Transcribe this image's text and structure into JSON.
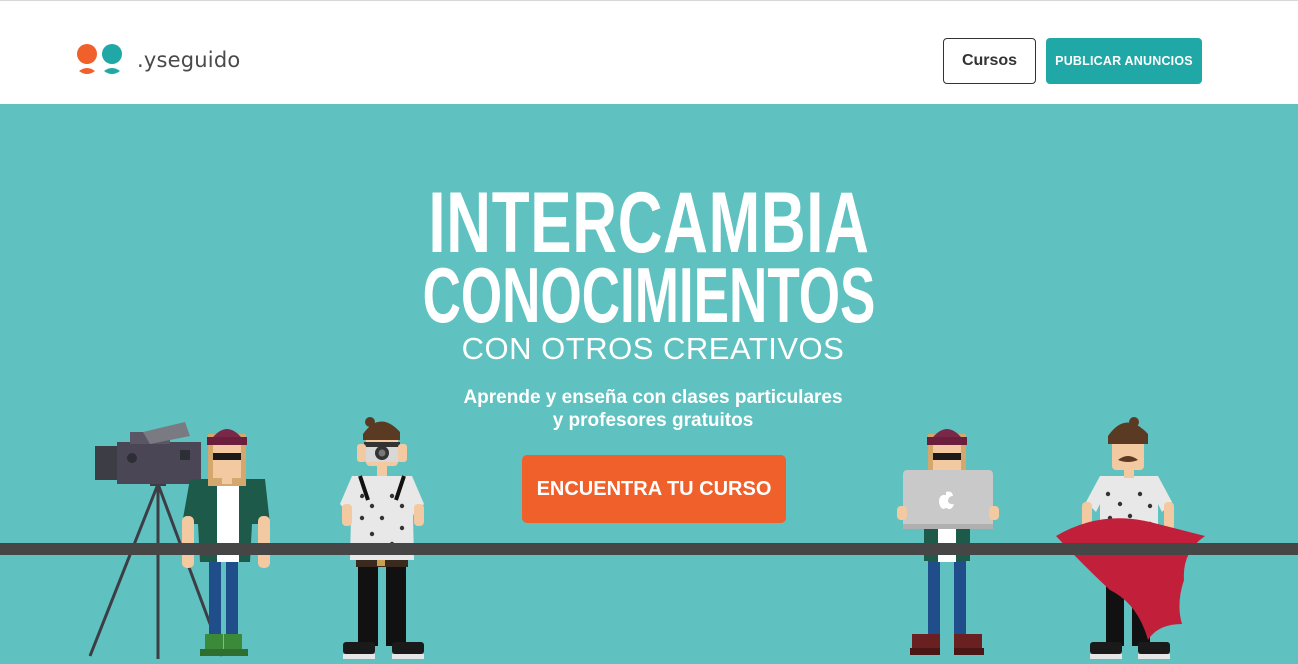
{
  "header": {
    "brand": ".yseguido",
    "nav": {
      "cursos_label": "Cursos",
      "publicar_label": "PUBLICAR ANUNCIOS"
    }
  },
  "hero": {
    "headline_line1": "INTERCAMBIA",
    "headline_line2": "CONOCIMIENTOS",
    "headline_line3": "CON OTROS CREATIVOS",
    "subtitle_line1": "Aprende y enseña con clases particulares",
    "subtitle_line2": "y profesores gratuitos",
    "cta_label": "ENCUENTRA TU CURSO"
  },
  "colors": {
    "accent_teal": "#1fa8a6",
    "hero_background": "#5fc2c0",
    "cta_orange": "#f0602a",
    "floor_bar": "#464646"
  },
  "icons": [
    "logo-mark-icon",
    "video-camera-icon",
    "photo-camera-icon",
    "laptop-icon",
    "cape-icon"
  ]
}
